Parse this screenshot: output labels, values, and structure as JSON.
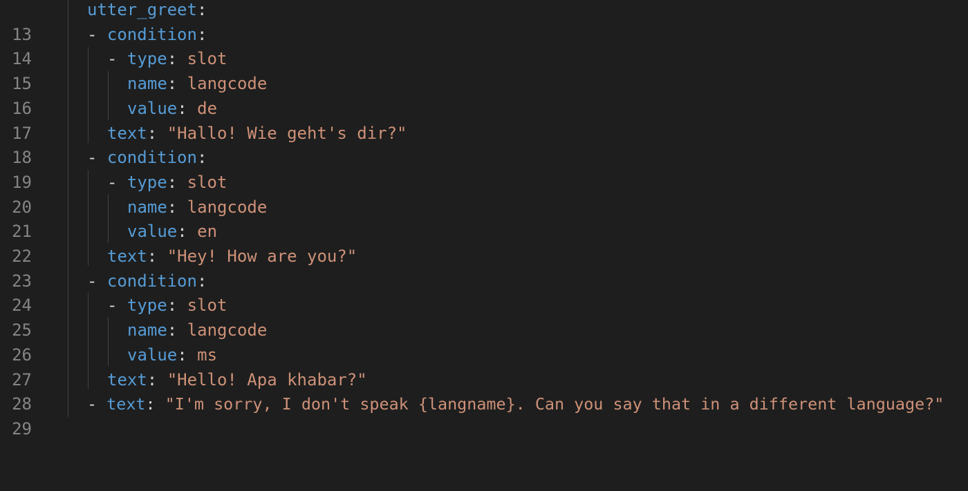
{
  "editor": {
    "lines": [
      {
        "number": "13",
        "dash": "",
        "key": "utter_greet",
        "sep": ":",
        "value": ""
      },
      {
        "number": "14",
        "dash": "- ",
        "key": "condition",
        "sep": ":",
        "value": ""
      },
      {
        "number": "15",
        "dash": "- ",
        "key": "type",
        "sep": ": ",
        "value": "slot"
      },
      {
        "number": "16",
        "dash": "",
        "key": "name",
        "sep": ": ",
        "value": "langcode"
      },
      {
        "number": "17",
        "dash": "",
        "key": "value",
        "sep": ": ",
        "value": "de"
      },
      {
        "number": "18",
        "dash": "",
        "key": "text",
        "sep": ": ",
        "value": "\"Hallo! Wie geht's dir?\""
      },
      {
        "number": "19",
        "dash": "- ",
        "key": "condition",
        "sep": ":",
        "value": ""
      },
      {
        "number": "20",
        "dash": "- ",
        "key": "type",
        "sep": ": ",
        "value": "slot"
      },
      {
        "number": "21",
        "dash": "",
        "key": "name",
        "sep": ": ",
        "value": "langcode"
      },
      {
        "number": "22",
        "dash": "",
        "key": "value",
        "sep": ": ",
        "value": "en"
      },
      {
        "number": "23",
        "dash": "",
        "key": "text",
        "sep": ": ",
        "value": "\"Hey! How are you?\""
      },
      {
        "number": "24",
        "dash": "- ",
        "key": "condition",
        "sep": ":",
        "value": ""
      },
      {
        "number": "25",
        "dash": "- ",
        "key": "type",
        "sep": ": ",
        "value": "slot"
      },
      {
        "number": "26",
        "dash": "",
        "key": "name",
        "sep": ": ",
        "value": "langcode"
      },
      {
        "number": "27",
        "dash": "",
        "key": "value",
        "sep": ": ",
        "value": "ms"
      },
      {
        "number": "28",
        "dash": "",
        "key": "text",
        "sep": ": ",
        "value": "\"Hello! Apa khabar?\""
      },
      {
        "number": "29",
        "dash": "- ",
        "key": "text",
        "sep": ": ",
        "value": "\"I'm sorry, I don't speak {langname}. Can you say that in a different language?\""
      }
    ],
    "colors": {
      "background": "#1e1e1e",
      "line_number": "#858585",
      "key": "#569cd6",
      "string": "#ce9178",
      "text": "#d4d4d4",
      "indent_guide": "#404040"
    }
  }
}
